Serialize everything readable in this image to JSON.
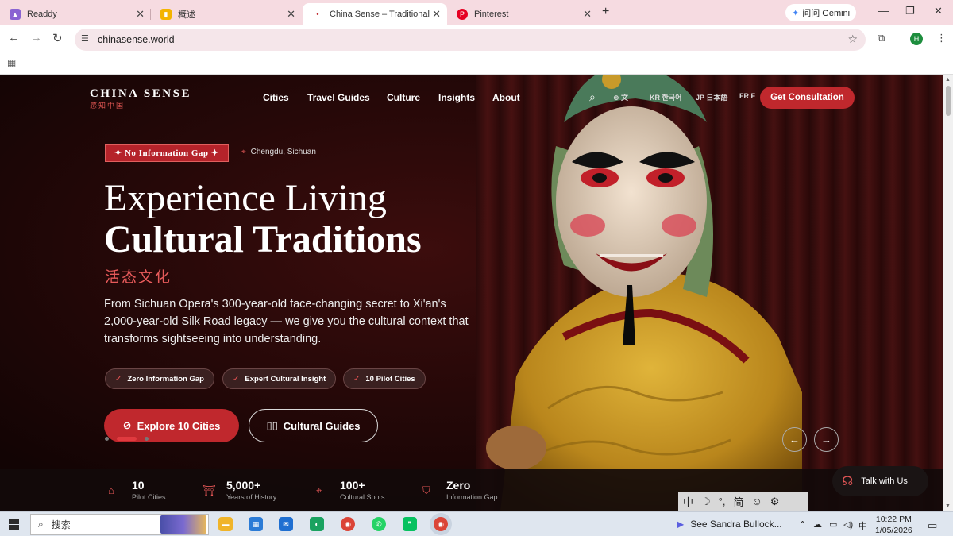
{
  "browser": {
    "tabs": [
      {
        "title": "Readdy",
        "active": false
      },
      {
        "title": "概述",
        "active": false
      },
      {
        "title": "China Sense – Traditional Cul",
        "active": true
      },
      {
        "title": "Pinterest",
        "active": false
      }
    ],
    "gemini_label": "问问 Gemini",
    "url": "chinasense.world",
    "profile_initial": "H"
  },
  "site": {
    "brand": "CHINA SENSE",
    "brand_sub": "感知中国",
    "nav": [
      "Cities",
      "Travel Guides",
      "Culture",
      "Insights",
      "About"
    ],
    "languages": [
      {
        "code": "文",
        "label": ""
      },
      {
        "code": "KR",
        "label": "한국어"
      },
      {
        "code": "JP",
        "label": "日本語"
      },
      {
        "code": "FR",
        "label": "F"
      }
    ],
    "cta": "Get Consultation"
  },
  "hero": {
    "badge": "✦ No Information Gap ✦",
    "location": "Chengdu, Sichuan",
    "title_line1": "Experience Living",
    "title_line2": "Cultural Traditions",
    "title_cn": "活态文化",
    "description": "From Sichuan Opera's 300-year-old face-changing secret to Xi'an's 2,000-year-old Silk Road legacy — we give you the cultural context that transforms sightseeing into understanding.",
    "pills": [
      "Zero Information Gap",
      "Expert Cultural Insight",
      "10 Pilot Cities"
    ],
    "primary_button": "Explore 10 Cities",
    "secondary_button": "Cultural Guides",
    "slides_total": 3,
    "slide_active": 2
  },
  "stats": [
    {
      "value": "10",
      "label": "Pilot Cities",
      "icon": "building-icon"
    },
    {
      "value": "5,000+",
      "label": "Years of History",
      "icon": "temple-icon"
    },
    {
      "value": "100+",
      "label": "Cultural Spots",
      "icon": "map-pin-icon"
    },
    {
      "value": "Zero",
      "label": "Information Gap",
      "icon": "shield-icon"
    }
  ],
  "talk_button": "Talk with Us",
  "ime": {
    "items": [
      "中",
      "☽",
      "°,",
      "简",
      "☺",
      "⚙"
    ]
  },
  "taskbar": {
    "search_placeholder": "搜索",
    "notification": "See Sandra Bullock...",
    "ime_indicator": "中",
    "time": "10:22 PM",
    "date": "1/05/2026"
  },
  "colors": {
    "accent": "#c0282d",
    "accent_light": "#e65a5a",
    "hero_bg": "#260808"
  }
}
